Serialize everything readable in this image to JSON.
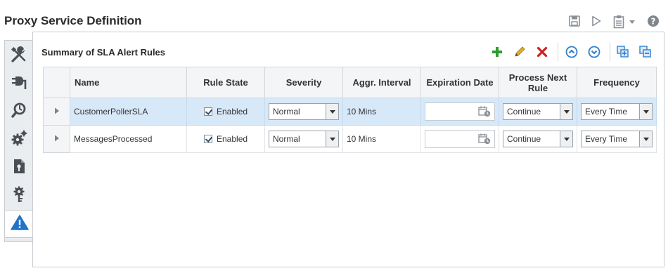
{
  "page": {
    "title": "Proxy Service Definition"
  },
  "section": {
    "title": "Summary of SLA Alert Rules"
  },
  "columns": {
    "name": "Name",
    "rule_state": "Rule State",
    "severity": "Severity",
    "aggr_interval": "Aggr. Interval",
    "expiration_date": "Expiration Date",
    "process_next_rule": "Process Next Rule",
    "frequency": "Frequency"
  },
  "rows": [
    {
      "name": "CustomerPollerSLA",
      "rule_state": "Enabled",
      "severity": "Normal",
      "aggr_interval": "10 Mins",
      "expiration_date": "",
      "process_next_rule": "Continue",
      "frequency": "Every Time",
      "selected": true
    },
    {
      "name": "MessagesProcessed",
      "rule_state": "Enabled",
      "severity": "Normal",
      "aggr_interval": "10 Mins",
      "expiration_date": "",
      "process_next_rule": "Continue",
      "frequency": "Every Time",
      "selected": false
    }
  ],
  "icons": {
    "top_tools": [
      "save-icon",
      "run-icon",
      "clipboard-icon",
      "dropdown-arrow-icon",
      "help-icon"
    ],
    "toolbar": [
      "add-icon",
      "edit-icon",
      "delete-icon",
      "move-up-icon",
      "move-down-icon",
      "expand-all-icon",
      "collapse-all-icon"
    ],
    "side_tabs": [
      "configuration-tools-icon",
      "transport-plug-icon",
      "message-search-icon",
      "settings-gears-icon",
      "security-document-icon",
      "key-gear-icon",
      "sla-alert-icon"
    ]
  },
  "colors": {
    "add": "#2e9b2e",
    "edit": "#d9a21b",
    "delete": "#cc2222",
    "move": "#2f7fd1",
    "selected_row": "#d7e8f8",
    "alert_tab": "#1f73c8"
  }
}
